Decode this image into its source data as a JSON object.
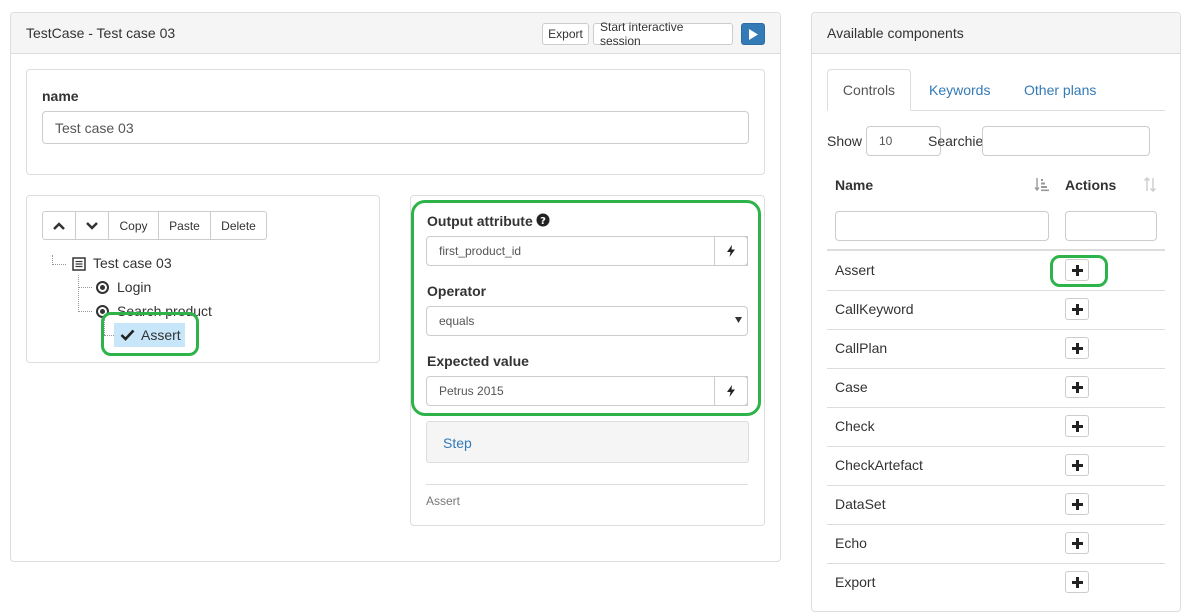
{
  "main_panel": {
    "title": "TestCase - Test case 03",
    "export_label": "Export",
    "interactive_label": "Start interactive session"
  },
  "name_section": {
    "label": "name",
    "value": "Test case 03"
  },
  "tree_toolbar": {
    "copy_label": "Copy",
    "paste_label": "Paste",
    "delete_label": "Delete"
  },
  "tree": {
    "root": "Test case 03",
    "login": "Login",
    "search": "Search product",
    "assert": "Assert"
  },
  "editor": {
    "output_label": "Output attribute",
    "output_value": "first_product_id",
    "operator_label": "Operator",
    "operator_value": "equals",
    "expected_label": "Expected value",
    "expected_value": "Petrus 2015",
    "step_label": "Step",
    "footer_type": "Assert"
  },
  "components_panel": {
    "title": "Available components",
    "tabs": [
      "Controls",
      "Keywords",
      "Other plans"
    ],
    "show_label": "Show",
    "entries_value": "10",
    "search_overlap": "Searchies",
    "columns": [
      "Name",
      "Actions"
    ],
    "rows": [
      "Assert",
      "CallKeyword",
      "CallPlan",
      "Case",
      "Check",
      "CheckArtefact",
      "DataSet",
      "Echo",
      "Export"
    ]
  },
  "colors": {
    "highlight": "#2db34a",
    "primary": "#337ab7",
    "selected": "#c8e6fa"
  }
}
